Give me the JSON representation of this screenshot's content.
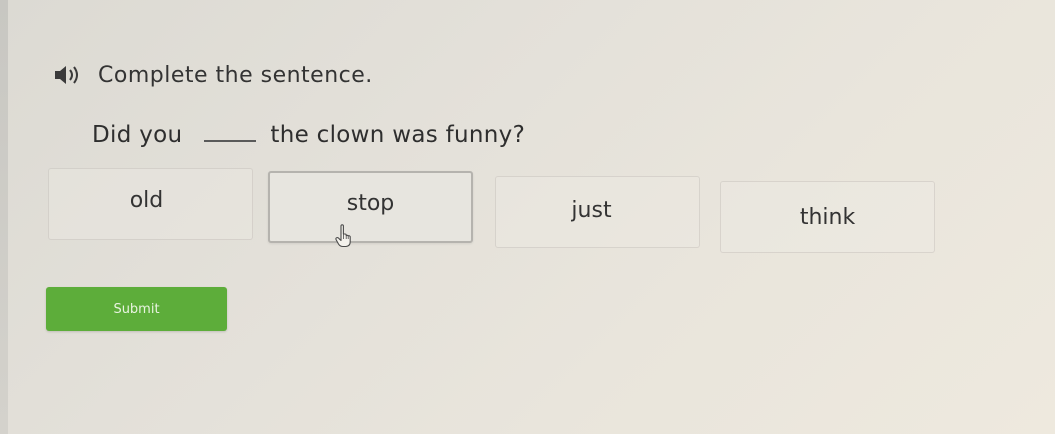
{
  "prompt": {
    "speaker_icon": "speaker-icon",
    "text": "Complete the sentence."
  },
  "sentence": {
    "before": "Did you",
    "after": "the clown was funny?"
  },
  "choices": [
    {
      "label": "old",
      "selected": false
    },
    {
      "label": "stop",
      "selected": true
    },
    {
      "label": "just",
      "selected": false
    },
    {
      "label": "think",
      "selected": false
    }
  ],
  "submit": {
    "label": "Submit",
    "color": "#5dad3a"
  }
}
